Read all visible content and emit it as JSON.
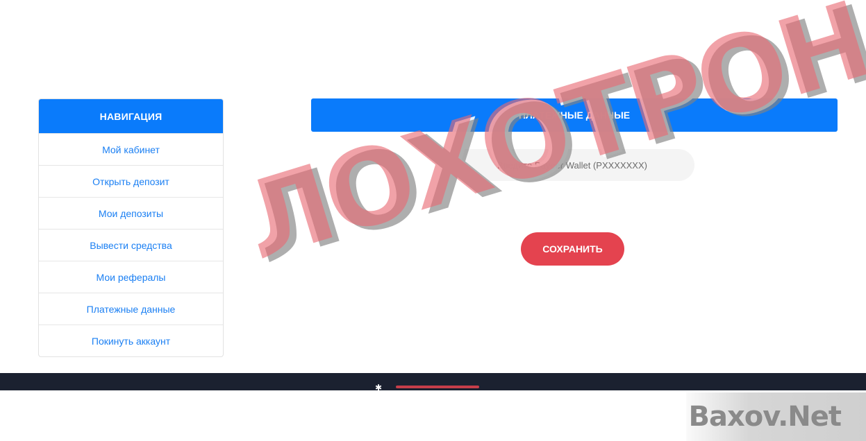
{
  "sidebar": {
    "title": "НАВИГАЦИЯ",
    "items": [
      {
        "label": "Мой кабинет"
      },
      {
        "label": "Открыть депозит"
      },
      {
        "label": "Мои депозиты"
      },
      {
        "label": "Вывести средства"
      },
      {
        "label": "Мои рефералы"
      },
      {
        "label": "Платежные данные"
      },
      {
        "label": "Покинуть аккаунт"
      }
    ]
  },
  "main": {
    "title": "ПЛАТЕЖНЫЕ ДАННЫЕ",
    "wallet_placeholder": "Введите Payeer Wallet (PXXXXXXX)",
    "save_label": "СОХРАНИТЬ"
  },
  "overlay": {
    "stamp_text": "ЛОХОТРОН",
    "watermark": "Baxov.Net"
  },
  "colors": {
    "primary": "#0a7bfb",
    "button": "#e4434f",
    "footer": "#1b2130",
    "link": "#1a7ff3"
  }
}
